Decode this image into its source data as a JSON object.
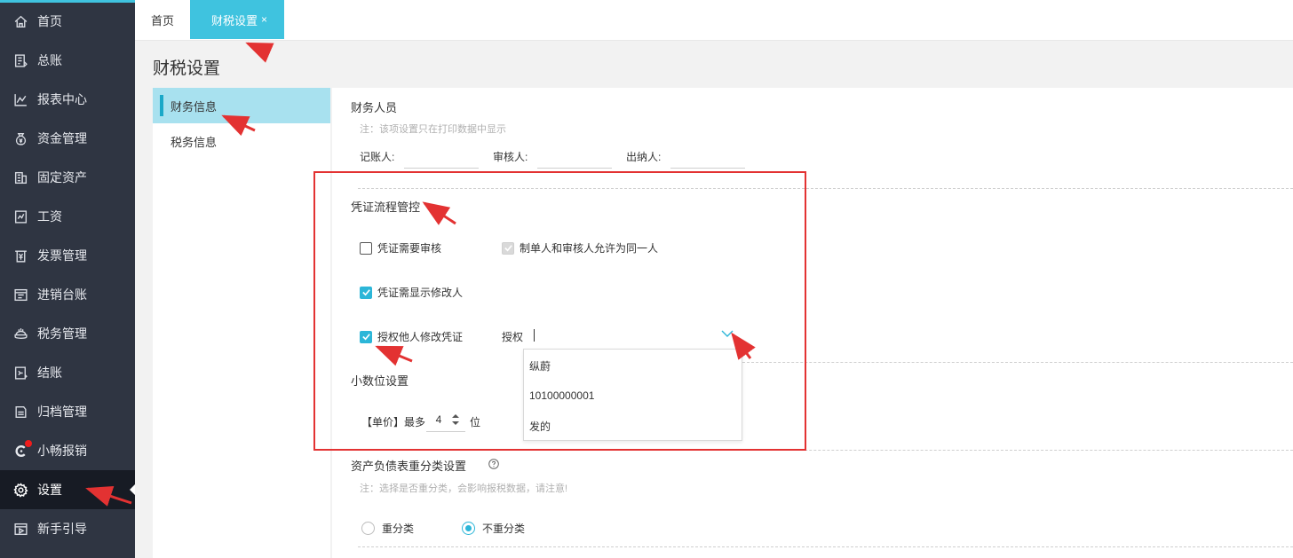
{
  "sidebar": {
    "items": [
      {
        "label": "首页",
        "icon": "home-icon"
      },
      {
        "label": "总账",
        "icon": "ledger-icon"
      },
      {
        "label": "报表中心",
        "icon": "report-chart-icon"
      },
      {
        "label": "资金管理",
        "icon": "money-bag-icon"
      },
      {
        "label": "固定资产",
        "icon": "building-icon"
      },
      {
        "label": "工资",
        "icon": "salary-icon"
      },
      {
        "label": "发票管理",
        "icon": "invoice-icon"
      },
      {
        "label": "进销台账",
        "icon": "inventory-icon"
      },
      {
        "label": "税务管理",
        "icon": "tax-icon"
      },
      {
        "label": "结账",
        "icon": "checkout-icon"
      },
      {
        "label": "归档管理",
        "icon": "archive-icon"
      },
      {
        "label": "小畅报销",
        "icon": "reimburse-icon"
      },
      {
        "label": "设置",
        "icon": "gear-icon"
      },
      {
        "label": "新手引导",
        "icon": "guide-icon"
      }
    ]
  },
  "tabs": {
    "home": "首页",
    "active": "财税设置",
    "close_glyph": "×"
  },
  "page_title": "财税设置",
  "submenu": {
    "items": [
      "财务信息",
      "税务信息"
    ]
  },
  "finance_staff": {
    "title": "财务人员",
    "note": "注：该项设置只在打印数据中显示",
    "bookkeeper_label": "记账人:",
    "reviewer_label": "审核人:",
    "cashier_label": "出纳人:"
  },
  "voucher_flow": {
    "title": "凭证流程管控",
    "require_review": "凭证需要审核",
    "same_person_allowed": "制单人和审核人允许为同一人",
    "show_modifier": "凭证需显示修改人",
    "authorize_others": "授权他人修改凭证",
    "authorize_label": "授权",
    "options": [
      "纵蔚",
      "10100000001",
      "发的"
    ]
  },
  "decimal": {
    "title": "小数位设置",
    "prefix": "【单价】最多",
    "value": "4",
    "suffix": "位"
  },
  "balance_sheet": {
    "title": "资产负债表重分类设置",
    "note": "注：选择是否重分类，会影响报税数据，请注意!",
    "option_reclass": "重分类",
    "option_no_reclass": "不重分类"
  },
  "colors": {
    "accent": "#3fc3df",
    "sidebar_bg": "#2f3542",
    "annotation_red": "#e33232"
  }
}
